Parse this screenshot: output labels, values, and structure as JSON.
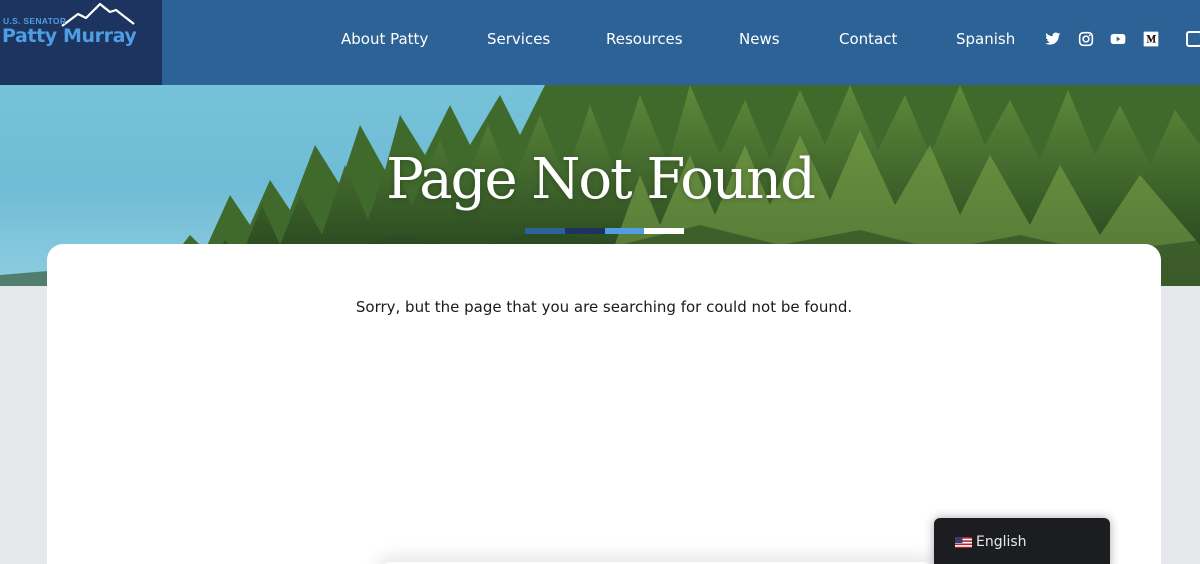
{
  "header": {
    "logo": {
      "small_text": "U.S. SENATOR",
      "name": "Patty Murray",
      "mountain_icon": "mountain-icon"
    },
    "nav": [
      {
        "label": "About Patty"
      },
      {
        "label": "Services"
      },
      {
        "label": "Resources"
      },
      {
        "label": "News"
      },
      {
        "label": "Contact"
      },
      {
        "label": "Spanish"
      }
    ],
    "social_icons": [
      "twitter-icon",
      "instagram-icon",
      "youtube-icon",
      "medium-icon"
    ]
  },
  "hero": {
    "title": "Page Not Found",
    "divider_colors": [
      "#2d6297",
      "#1d3461",
      "#4f9de3",
      "#ffffff"
    ]
  },
  "content": {
    "message": "Sorry, but the page that you are searching for could not be found."
  },
  "language_switcher": {
    "flag_icon": "us-flag-icon",
    "label": "English"
  },
  "colors": {
    "header_bg": "#2d6297",
    "logo_bg": "#1d3461",
    "logo_text": "#4f9de3",
    "page_bg": "#e6e8ec",
    "lang_bg": "#1b1d21"
  }
}
